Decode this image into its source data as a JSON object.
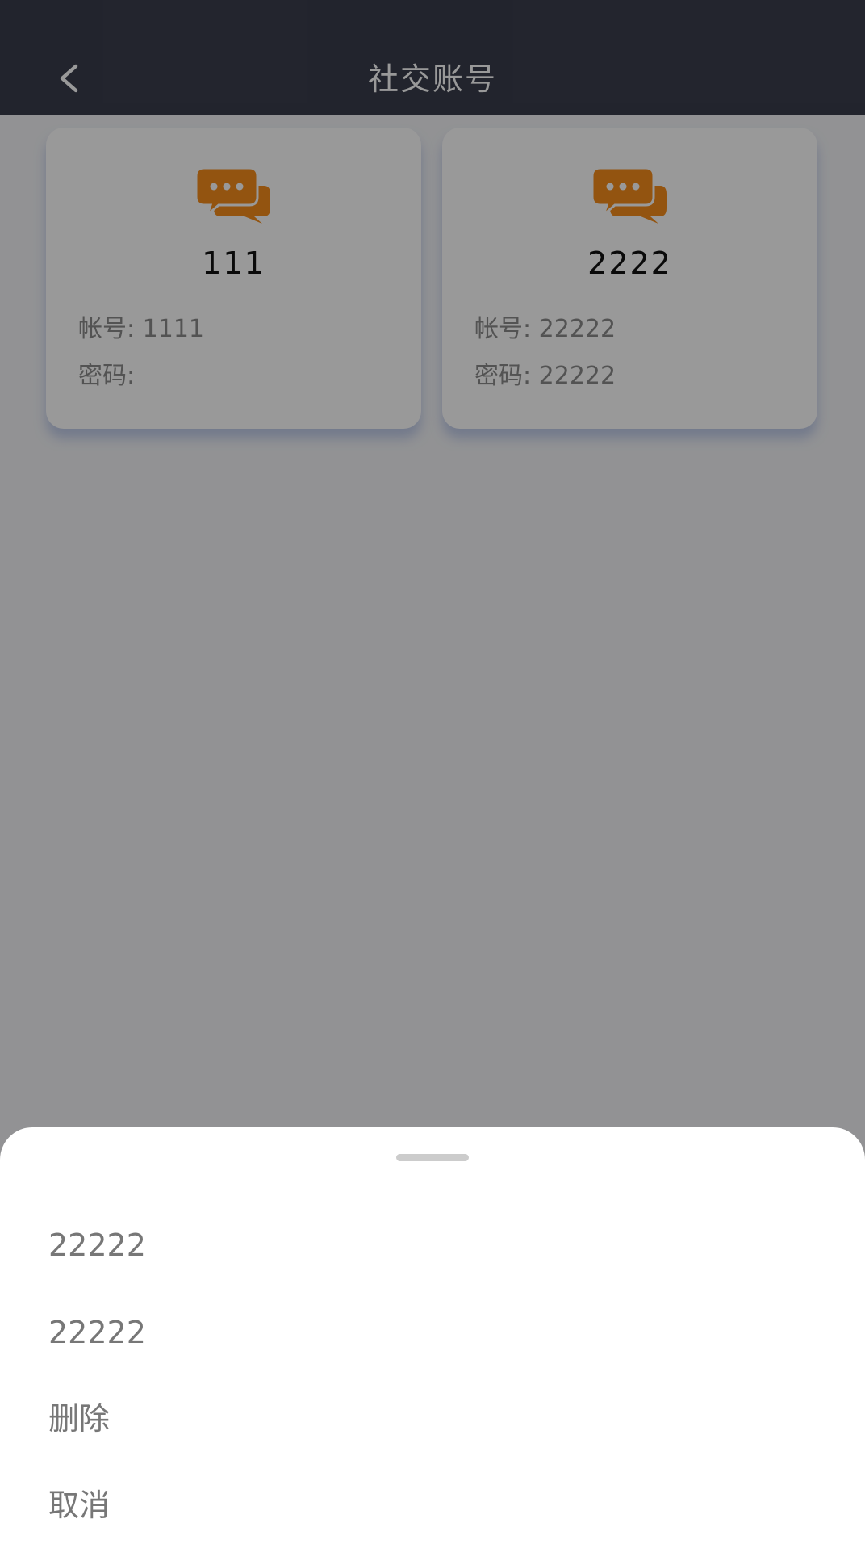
{
  "header": {
    "title": "社交账号",
    "back_icon": "chevron-left-icon"
  },
  "accounts": [
    {
      "icon": "chat-bubbles-icon",
      "name": "111",
      "account_line": "帐号: 1111",
      "password_line": "密码:"
    },
    {
      "icon": "chat-bubbles-icon",
      "name": "2222",
      "account_line": "帐号: 22222",
      "password_line": "密码: 22222"
    }
  ],
  "action_sheet": {
    "items": [
      "22222",
      "22222",
      "删除",
      "取消"
    ]
  },
  "colors": {
    "header_bg": "#3a3d4c",
    "icon_accent": "#f58d1c",
    "overlay": "rgba(0,0,0,0.4)"
  }
}
